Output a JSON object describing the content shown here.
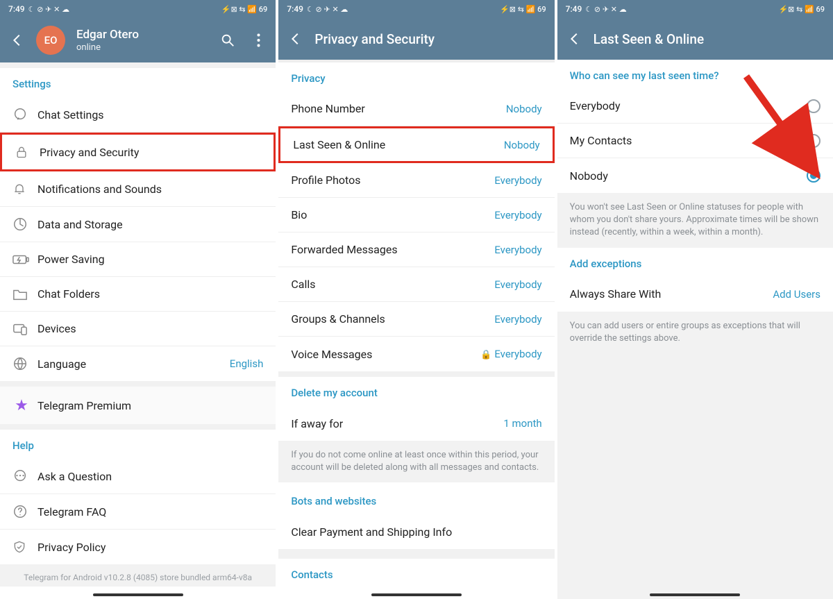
{
  "statusbar": {
    "time": "7:49",
    "icons_left": "☾ ⊘ ✈ ✕ ☁",
    "icons_right": "⚡⊠ ⇆ 📶 69"
  },
  "colors": {
    "header_bg": "#5c7e97",
    "accent": "#2c97c4",
    "highlight": "#e02b1f"
  },
  "screen1": {
    "avatar": "EO",
    "name": "Edgar Otero",
    "status": "online",
    "settings_header": "Settings",
    "items": [
      {
        "label": "Chat Settings"
      },
      {
        "label": "Privacy and Security"
      },
      {
        "label": "Notifications and Sounds"
      },
      {
        "label": "Data and Storage"
      },
      {
        "label": "Power Saving"
      },
      {
        "label": "Chat Folders"
      },
      {
        "label": "Devices"
      },
      {
        "label": "Language",
        "value": "English"
      }
    ],
    "premium": "Telegram Premium",
    "help_header": "Help",
    "help_items": [
      {
        "label": "Ask a Question"
      },
      {
        "label": "Telegram FAQ"
      },
      {
        "label": "Privacy Policy"
      }
    ],
    "version": "Telegram for Android v10.2.8 (4085) store bundled arm64-v8a"
  },
  "screen2": {
    "title": "Privacy and Security",
    "privacy_header": "Privacy",
    "privacy_items": [
      {
        "label": "Phone Number",
        "value": "Nobody"
      },
      {
        "label": "Last Seen & Online",
        "value": "Nobody"
      },
      {
        "label": "Profile Photos",
        "value": "Everybody"
      },
      {
        "label": "Bio",
        "value": "Everybody"
      },
      {
        "label": "Forwarded Messages",
        "value": "Everybody"
      },
      {
        "label": "Calls",
        "value": "Everybody"
      },
      {
        "label": "Groups & Channels",
        "value": "Everybody"
      },
      {
        "label": "Voice Messages",
        "value": "Everybody",
        "locked": true
      }
    ],
    "delete_header": "Delete my account",
    "delete_item": {
      "label": "If away for",
      "value": "1 month"
    },
    "delete_desc": "If you do not come online at least once within this period, your account will be deleted along with all messages and contacts.",
    "bots_header": "Bots and websites",
    "bots_item": "Clear Payment and Shipping Info",
    "contacts_header": "Contacts"
  },
  "screen3": {
    "title": "Last Seen & Online",
    "who_header": "Who can see my last seen time?",
    "options": [
      {
        "label": "Everybody",
        "selected": false
      },
      {
        "label": "My Contacts",
        "selected": false
      },
      {
        "label": "Nobody",
        "selected": true
      }
    ],
    "who_desc": "You won't see Last Seen or Online statuses for people with whom you don't share yours. Approximate times will be shown instead (recently, within a week, within a month).",
    "except_header": "Add exceptions",
    "except_item": {
      "label": "Always Share With",
      "value": "Add Users"
    },
    "except_desc": "You can add users or entire groups as exceptions that will override the settings above."
  }
}
